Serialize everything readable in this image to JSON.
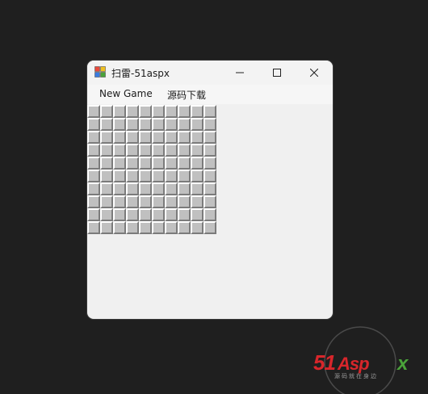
{
  "window": {
    "title": "扫雷-51aspx"
  },
  "menu": {
    "items": [
      {
        "label": "New Game"
      },
      {
        "label": "源码下载"
      }
    ]
  },
  "board": {
    "rows": 10,
    "cols": 10,
    "state": "all-covered"
  },
  "watermark": {
    "logo_text": "51Aspx",
    "tagline": "源码就在身边"
  },
  "colors": {
    "background": "#1f1f1f",
    "window": "#f0f0f0",
    "cell": "#c0c0c0",
    "watermark_red": "#d8262b",
    "watermark_green": "#4aa33a"
  }
}
